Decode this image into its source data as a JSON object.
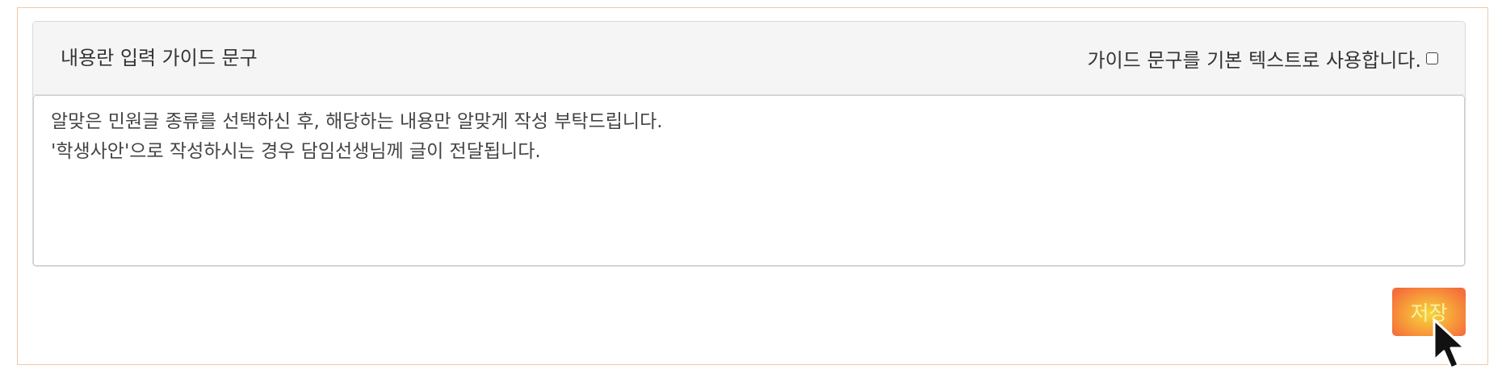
{
  "panel": {
    "header_title": "내용란 입력 가이드 문구",
    "use_default_label": "가이드 문구를 기본 텍스트로 사용합니다.",
    "use_default_checked": false
  },
  "guide_text": {
    "line1": "알맞은 민원글 종류를 선택하신 후, 해당하는 내용만 알맞게 작성 부탁드립니다.",
    "line2": "'학생사안'으로 작성하시는 경우 담임선생님께 글이 전달됩니다."
  },
  "actions": {
    "save_label": "저장"
  },
  "colors": {
    "frame_border": "#f3c7a6",
    "header_bg": "#f5f5f5",
    "save_gradient_center": "#f6d73a",
    "save_gradient_edge": "#f26a3a",
    "save_text": "#f7f2a4"
  },
  "icons": {
    "checkbox": "checkbox-icon",
    "cursor": "mouse-pointer-icon"
  }
}
